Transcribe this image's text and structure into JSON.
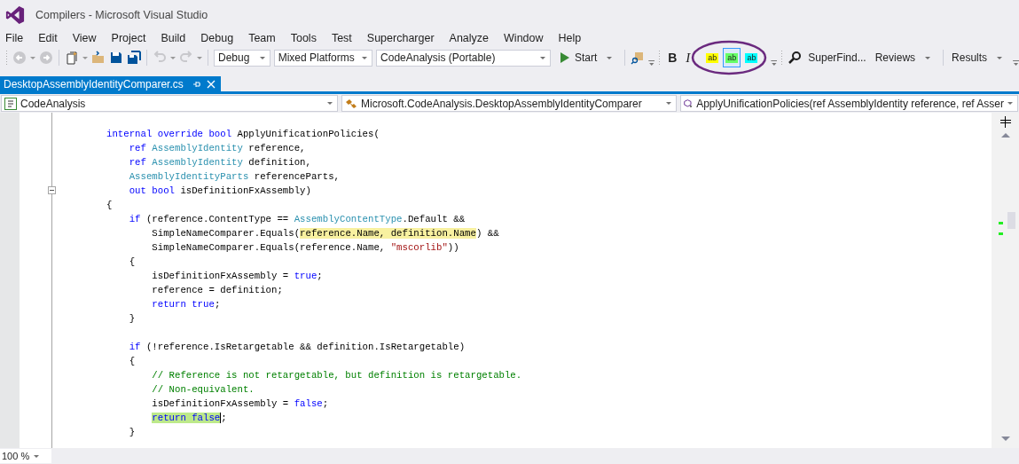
{
  "window": {
    "title": "Compilers - Microsoft Visual Studio"
  },
  "menu": [
    "File",
    "Edit",
    "View",
    "Project",
    "Build",
    "Debug",
    "Team",
    "Tools",
    "Test",
    "Supercharger",
    "Analyze",
    "Window",
    "Help"
  ],
  "toolbar": {
    "configuration": "Debug",
    "platform": "Mixed Platforms",
    "startup_project": "CodeAnalysis (Portable)",
    "start": "Start",
    "bold": "B",
    "italic": "I",
    "highlighters": [
      {
        "label": "ab",
        "color": "#ffff00",
        "selected": false
      },
      {
        "label": "ab",
        "color": "#66ff66",
        "selected": true
      },
      {
        "label": "ab",
        "color": "#00ffff",
        "selected": false
      }
    ],
    "superfind": "SuperFind...",
    "reviews": "Reviews",
    "results": "Results"
  },
  "tab": {
    "title": "DesktopAssemblyIdentityComparer.cs",
    "selected": true
  },
  "navigation": {
    "project": "CodeAnalysis",
    "type": "Microsoft.CodeAnalysis.DesktopAssemblyIdentityComparer",
    "member": "ApplyUnificationPolicies(ref AssemblyIdentity reference, ref Asser"
  },
  "code_lines": [
    {
      "kind": "code",
      "segments": [
        {
          "tokens": [
            {
              "kind": "keyword",
              "text": "internal override bool"
            },
            {
              "kind": "plain",
              "text": " ApplyUnificationPolicies("
            }
          ]
        }
      ]
    },
    {
      "kind": "code",
      "segments": [
        {
          "tokens": [
            {
              "kind": "keyword",
              "text": "    ref"
            },
            {
              "kind": "type",
              "text": " AssemblyIdentity"
            },
            {
              "kind": "plain",
              "text": " reference,"
            }
          ]
        }
      ]
    },
    {
      "kind": "code",
      "segments": [
        {
          "tokens": [
            {
              "kind": "keyword",
              "text": "    ref"
            },
            {
              "kind": "type",
              "text": " AssemblyIdentity"
            },
            {
              "kind": "plain",
              "text": " definition,"
            }
          ]
        }
      ]
    },
    {
      "kind": "code",
      "segments": [
        {
          "tokens": [
            {
              "kind": "type",
              "text": "    AssemblyIdentityParts"
            },
            {
              "kind": "plain",
              "text": " referenceParts,"
            }
          ]
        }
      ]
    },
    {
      "kind": "code",
      "outline_toggle": true,
      "segments": [
        {
          "tokens": [
            {
              "kind": "keyword",
              "text": "    out bool"
            },
            {
              "kind": "plain",
              "text": " isDefinitionFxAssembly)"
            }
          ]
        }
      ]
    },
    {
      "kind": "code",
      "segments": [
        {
          "tokens": [
            {
              "kind": "plain",
              "text": "{"
            }
          ]
        }
      ]
    },
    {
      "kind": "code",
      "segments": [
        {
          "tokens": [
            {
              "kind": "keyword",
              "text": "    if"
            },
            {
              "kind": "plain",
              "text": " (reference.ContentType == "
            },
            {
              "kind": "type",
              "text": "AssemblyContentType"
            },
            {
              "kind": "plain",
              "text": ".Default &&"
            }
          ]
        }
      ]
    },
    {
      "kind": "code",
      "segments": [
        {
          "tokens": [
            {
              "kind": "plain",
              "text": "        SimpleNameComparer.Equals("
            }
          ]
        },
        {
          "highlighted": true,
          "color": "#f8f1a0",
          "tokens": [
            {
              "kind": "plain",
              "text": "reference.Name, definition.Name"
            }
          ]
        },
        {
          "tokens": [
            {
              "kind": "plain",
              "text": ") &&"
            }
          ]
        }
      ]
    },
    {
      "kind": "code",
      "segments": [
        {
          "tokens": [
            {
              "kind": "plain",
              "text": "        SimpleNameComparer.Equals(reference.Name, "
            },
            {
              "kind": "string",
              "text": "\"mscorlib\""
            },
            {
              "kind": "plain",
              "text": "))"
            }
          ]
        }
      ]
    },
    {
      "kind": "code",
      "segments": [
        {
          "tokens": [
            {
              "kind": "plain",
              "text": "    {"
            }
          ]
        }
      ]
    },
    {
      "kind": "code",
      "segments": [
        {
          "tokens": [
            {
              "kind": "plain",
              "text": "        isDefinitionFxAssembly = "
            },
            {
              "kind": "keyword",
              "text": "true"
            },
            {
              "kind": "plain",
              "text": ";"
            }
          ]
        }
      ]
    },
    {
      "kind": "code",
      "segments": [
        {
          "tokens": [
            {
              "kind": "plain",
              "text": "        reference = definition;"
            }
          ]
        }
      ]
    },
    {
      "kind": "code",
      "segments": [
        {
          "tokens": [
            {
              "kind": "keyword",
              "text": "        return true"
            },
            {
              "kind": "plain",
              "text": ";"
            }
          ]
        }
      ]
    },
    {
      "kind": "code",
      "segments": [
        {
          "tokens": [
            {
              "kind": "plain",
              "text": "    }"
            }
          ]
        }
      ]
    },
    {
      "kind": "blank"
    },
    {
      "kind": "code",
      "segments": [
        {
          "tokens": [
            {
              "kind": "keyword",
              "text": "    if"
            },
            {
              "kind": "plain",
              "text": " (!reference.IsRetargetable && definition.IsRetargetable)"
            }
          ]
        }
      ]
    },
    {
      "kind": "code",
      "segments": [
        {
          "tokens": [
            {
              "kind": "plain",
              "text": "    {"
            }
          ]
        }
      ]
    },
    {
      "kind": "code",
      "segments": [
        {
          "tokens": [
            {
              "kind": "comment",
              "text": "        // Reference is not retargetable, but definition is retargetable."
            }
          ]
        }
      ]
    },
    {
      "kind": "code",
      "segments": [
        {
          "tokens": [
            {
              "kind": "comment",
              "text": "        // Non-equivalent."
            }
          ]
        }
      ]
    },
    {
      "kind": "code",
      "segments": [
        {
          "tokens": [
            {
              "kind": "plain",
              "text": "        isDefinitionFxAssembly = "
            },
            {
              "kind": "keyword",
              "text": "false"
            },
            {
              "kind": "plain",
              "text": ";"
            }
          ]
        }
      ]
    },
    {
      "kind": "code",
      "segments": [
        {
          "highlighted": true,
          "color": "#bde98a",
          "caret": true,
          "tokens": [
            {
              "kind": "keyword",
              "text": "        return false"
            }
          ]
        },
        {
          "tokens": [
            {
              "kind": "plain",
              "text": ";"
            }
          ]
        }
      ]
    },
    {
      "kind": "code",
      "segments": [
        {
          "tokens": [
            {
              "kind": "plain",
              "text": "    }"
            }
          ]
        }
      ]
    }
  ],
  "status_bar": {
    "zoom": "100 %"
  }
}
